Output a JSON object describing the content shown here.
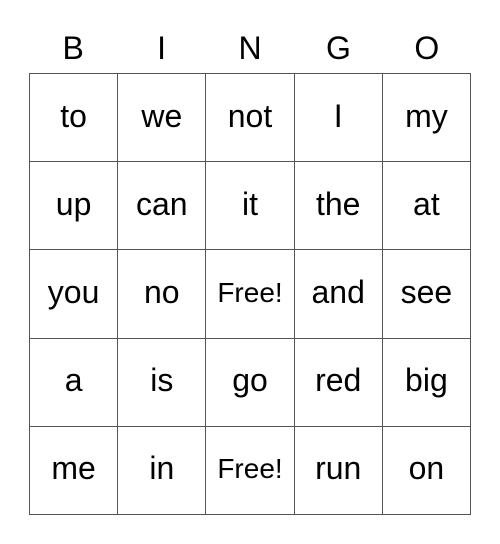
{
  "header": {
    "letters": [
      "B",
      "I",
      "N",
      "G",
      "O"
    ]
  },
  "board": {
    "rows": [
      [
        "to",
        "we",
        "not",
        "I",
        "my"
      ],
      [
        "up",
        "can",
        "it",
        "the",
        "at"
      ],
      [
        "you",
        "no",
        "Free!",
        "and",
        "see"
      ],
      [
        "a",
        "is",
        "go",
        "red",
        "big"
      ],
      [
        "me",
        "in",
        "Free!",
        "run",
        "on"
      ]
    ],
    "free_label": "Free!"
  }
}
